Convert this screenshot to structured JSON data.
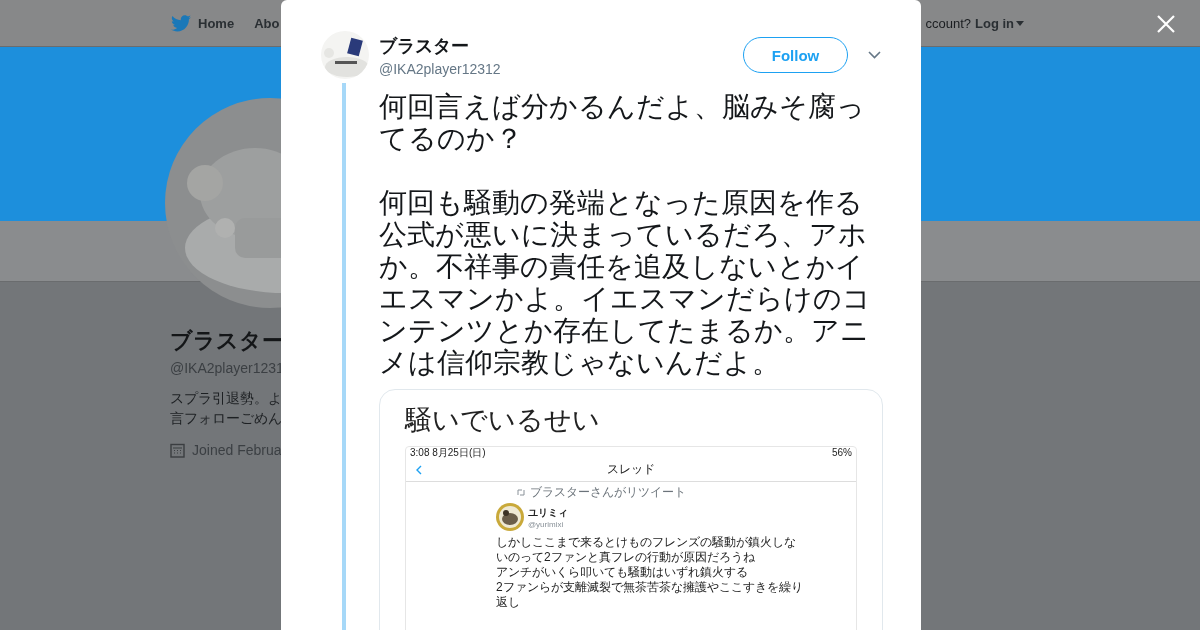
{
  "nav": {
    "items": [
      {
        "label": "Home",
        "kind": "home"
      },
      {
        "label": "Abo",
        "kind": "plain"
      }
    ],
    "account_prompt": "ccount?",
    "login": "Log in"
  },
  "profile": {
    "name": "ブラスター",
    "handle": "@IKA2player1231",
    "bio": [
      "スプラ引退勢。よ",
      "言フォローごめん"
    ],
    "joined": "Joined Februa"
  },
  "tweet": {
    "author": "ブラスター",
    "handle": "@IKA2player12312",
    "follow": "Follow",
    "paragraphs": [
      "何回言えば分かるんだよ、脳みそ腐ってるのか？",
      "何回も騒動の発端となった原因を作る公式が悪いに決まっているだろ、アホか。不祥事の責任を追及しないとかイエスマンかよ。イエスマンだらけのコンテンツとか存在してたまるか。アニメは信仰宗教じゃないんだよ。"
    ],
    "media": {
      "caption": "騒いでいるせい",
      "screenshot": {
        "status_time": "3:08  8月25日(日)",
        "status_battery": "56%",
        "title": "スレッド",
        "retweet_note": "ブラスターさんがリツイート",
        "name": "ユリミィ",
        "handle": "@yurimixi",
        "lines": [
          "しかしここまで来るとけものフレンズの騒動が鎮火しな",
          "いのって2ファンと真フレの行動が原因だろうね",
          "アンチがいくら叩いても騒動はいずれ鎮火する",
          "2ファンらが支離滅裂で無茶苦茶な擁護やここすきを繰り",
          "返し"
        ]
      }
    }
  }
}
